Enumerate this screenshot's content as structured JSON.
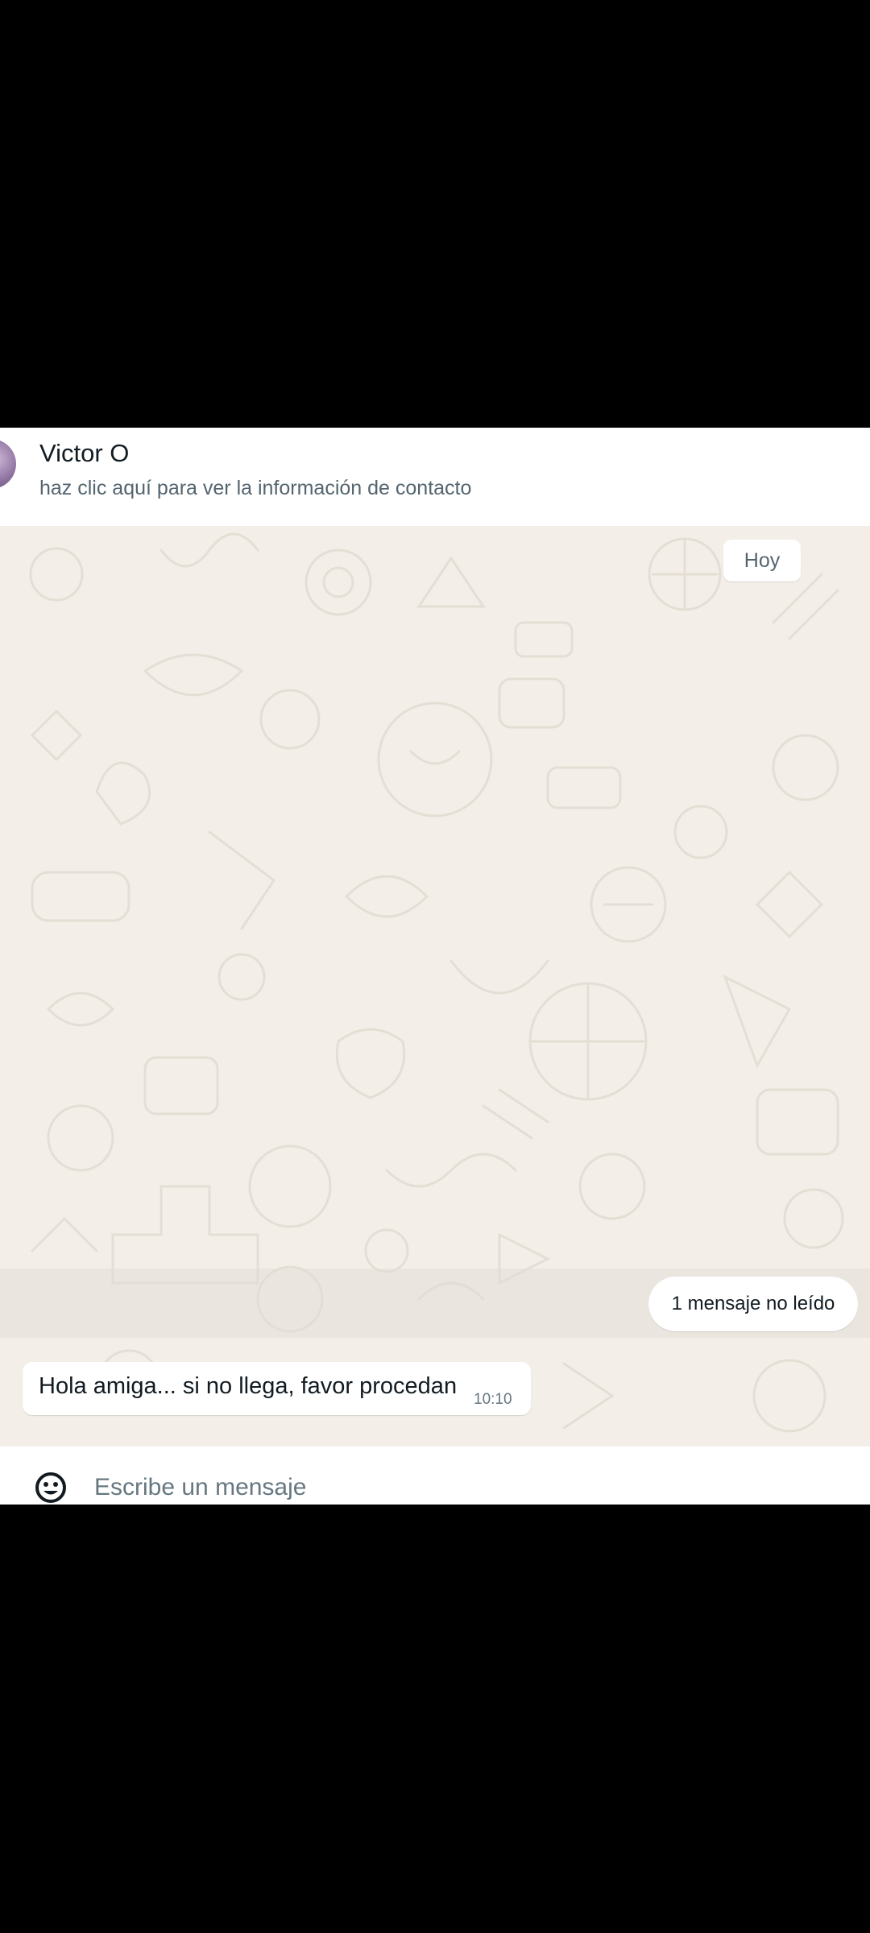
{
  "header": {
    "contact_name": "Victor O",
    "subtitle": "haz clic aquí para ver la información de contacto",
    "avatar_icon": "contact-avatar"
  },
  "messages": {
    "date_divider": "Hoy",
    "unread_divider": "1 mensaje no leído",
    "items": [
      {
        "direction": "incoming",
        "text": "Hola amiga... si no llega, favor procedan",
        "time": "10:10"
      }
    ]
  },
  "composer": {
    "placeholder": "Escribe un mensaje",
    "emoji_icon": "emoji-icon"
  },
  "colors": {
    "wallpaper": "#f3efe8",
    "doodle": "#e4ded4",
    "bubble_incoming": "#ffffff",
    "text_primary": "#111b21",
    "text_secondary": "#667781"
  }
}
